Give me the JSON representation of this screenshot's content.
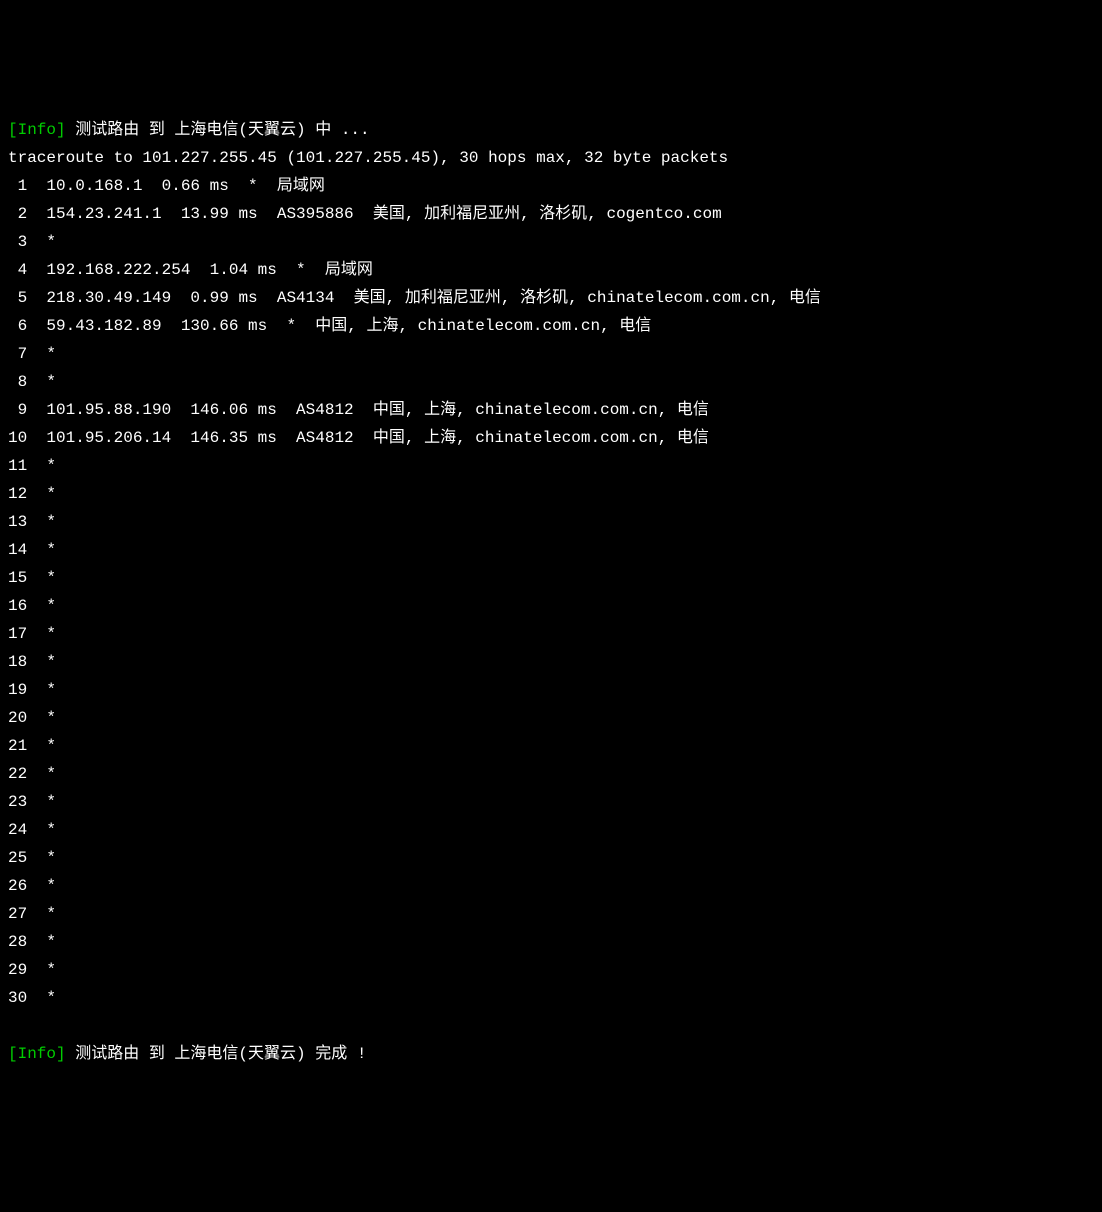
{
  "info_tag": "[Info]",
  "info_start": " 测试路由 到 上海电信(天翼云) 中 ...",
  "traceroute_header": "traceroute to 101.227.255.45 (101.227.255.45), 30 hops max, 32 byte packets",
  "hops": [
    {
      "num": "1",
      "rest": "  10.0.168.1  0.66 ms  *  局域网"
    },
    {
      "num": "2",
      "rest": "  154.23.241.1  13.99 ms  AS395886  美国, 加利福尼亚州, 洛杉矶, cogentco.com"
    },
    {
      "num": "3",
      "rest": "  *"
    },
    {
      "num": "4",
      "rest": "  192.168.222.254  1.04 ms  *  局域网"
    },
    {
      "num": "5",
      "rest": "  218.30.49.149  0.99 ms  AS4134  美国, 加利福尼亚州, 洛杉矶, chinatelecom.com.cn, 电信"
    },
    {
      "num": "6",
      "rest": "  59.43.182.89  130.66 ms  *  中国, 上海, chinatelecom.com.cn, 电信"
    },
    {
      "num": "7",
      "rest": "  *"
    },
    {
      "num": "8",
      "rest": "  *"
    },
    {
      "num": "9",
      "rest": "  101.95.88.190  146.06 ms  AS4812  中国, 上海, chinatelecom.com.cn, 电信"
    },
    {
      "num": "10",
      "rest": "  101.95.206.14  146.35 ms  AS4812  中国, 上海, chinatelecom.com.cn, 电信"
    },
    {
      "num": "11",
      "rest": "  *"
    },
    {
      "num": "12",
      "rest": "  *"
    },
    {
      "num": "13",
      "rest": "  *"
    },
    {
      "num": "14",
      "rest": "  *"
    },
    {
      "num": "15",
      "rest": "  *"
    },
    {
      "num": "16",
      "rest": "  *"
    },
    {
      "num": "17",
      "rest": "  *"
    },
    {
      "num": "18",
      "rest": "  *"
    },
    {
      "num": "19",
      "rest": "  *"
    },
    {
      "num": "20",
      "rest": "  *"
    },
    {
      "num": "21",
      "rest": "  *"
    },
    {
      "num": "22",
      "rest": "  *"
    },
    {
      "num": "23",
      "rest": "  *"
    },
    {
      "num": "24",
      "rest": "  *"
    },
    {
      "num": "25",
      "rest": "  *"
    },
    {
      "num": "26",
      "rest": "  *"
    },
    {
      "num": "27",
      "rest": "  *"
    },
    {
      "num": "28",
      "rest": "  *"
    },
    {
      "num": "29",
      "rest": "  *"
    },
    {
      "num": "30",
      "rest": "  *"
    }
  ],
  "info_end": " 测试路由 到 上海电信(天翼云) 完成 !"
}
